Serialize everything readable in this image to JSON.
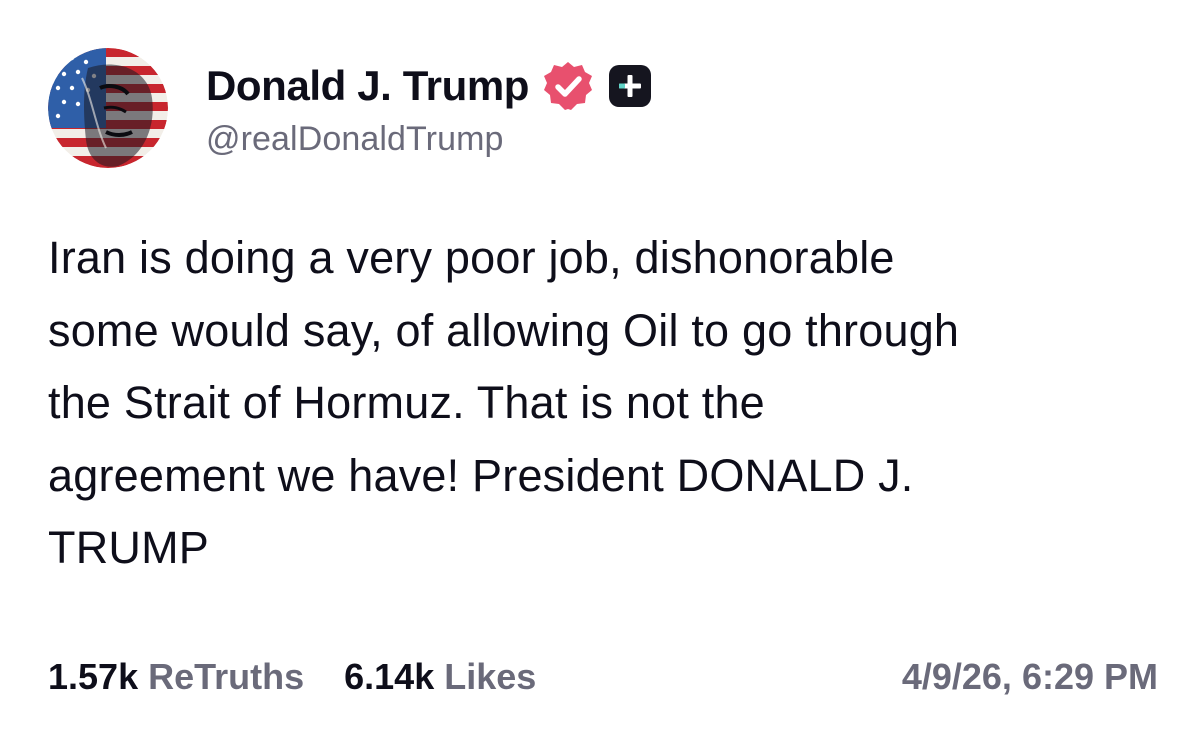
{
  "author": {
    "display_name": "Donald J. Trump",
    "handle": "@realDonaldTrump",
    "avatar_icon": "flag-portrait-avatar",
    "verified_icon": "verified-badge-icon",
    "plus_icon": "plus-badge-icon"
  },
  "post": {
    "text": "Iran is doing a very poor job, dishonorable\nsome would say, of allowing Oil to go through\nthe Strait of Hormuz. That is not the\nagreement we have! President DONALD J.\nTRUMP"
  },
  "stats": {
    "retruths_count": "1.57k",
    "retruths_label": "ReTruths",
    "likes_count": "6.14k",
    "likes_label": "Likes"
  },
  "timestamp": "4/9/26, 6:29 PM",
  "colors": {
    "text": "#0e0e1a",
    "muted": "#6a6a7a",
    "verified": "#e8506e",
    "plus_badge_bg": "#15151f",
    "plus_badge_accent": "#5fd3c7"
  }
}
